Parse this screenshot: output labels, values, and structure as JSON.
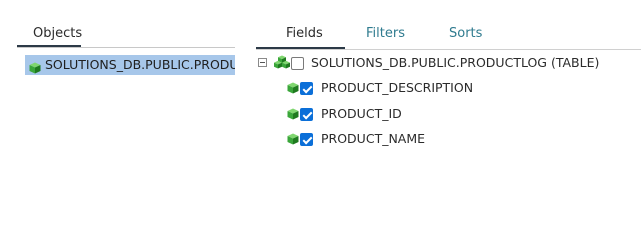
{
  "objects_panel": {
    "tab_label": "Objects",
    "items": [
      {
        "label": "SOLUTIONS_DB.PUBLIC.PRODU",
        "icon": "green-cube-icon",
        "selected": true
      }
    ]
  },
  "fields_panel": {
    "tabs": [
      {
        "label": "Fields",
        "active": true
      },
      {
        "label": "Filters",
        "active": false
      },
      {
        "label": "Sorts",
        "active": false
      }
    ],
    "table": {
      "label": "SOLUTIONS_DB.PUBLIC.PRODUCTLOG (TABLE)",
      "expanded": true,
      "checked": false,
      "icon": "green-cubes-icon"
    },
    "fields": [
      {
        "label": "PRODUCT_DESCRIPTION",
        "checked": true,
        "icon": "green-cube-icon"
      },
      {
        "label": "PRODUCT_ID",
        "checked": true,
        "icon": "green-cube-icon"
      },
      {
        "label": "PRODUCT_NAME",
        "checked": true,
        "icon": "green-cube-icon"
      }
    ]
  },
  "colors": {
    "selection": "#a7c7ea",
    "active_tab_underline": "#2c3a47",
    "inactive_tab_text": "#2f7b8f",
    "checkbox_checked": "#0b6fd8",
    "cube_green": "#3aa63a"
  }
}
